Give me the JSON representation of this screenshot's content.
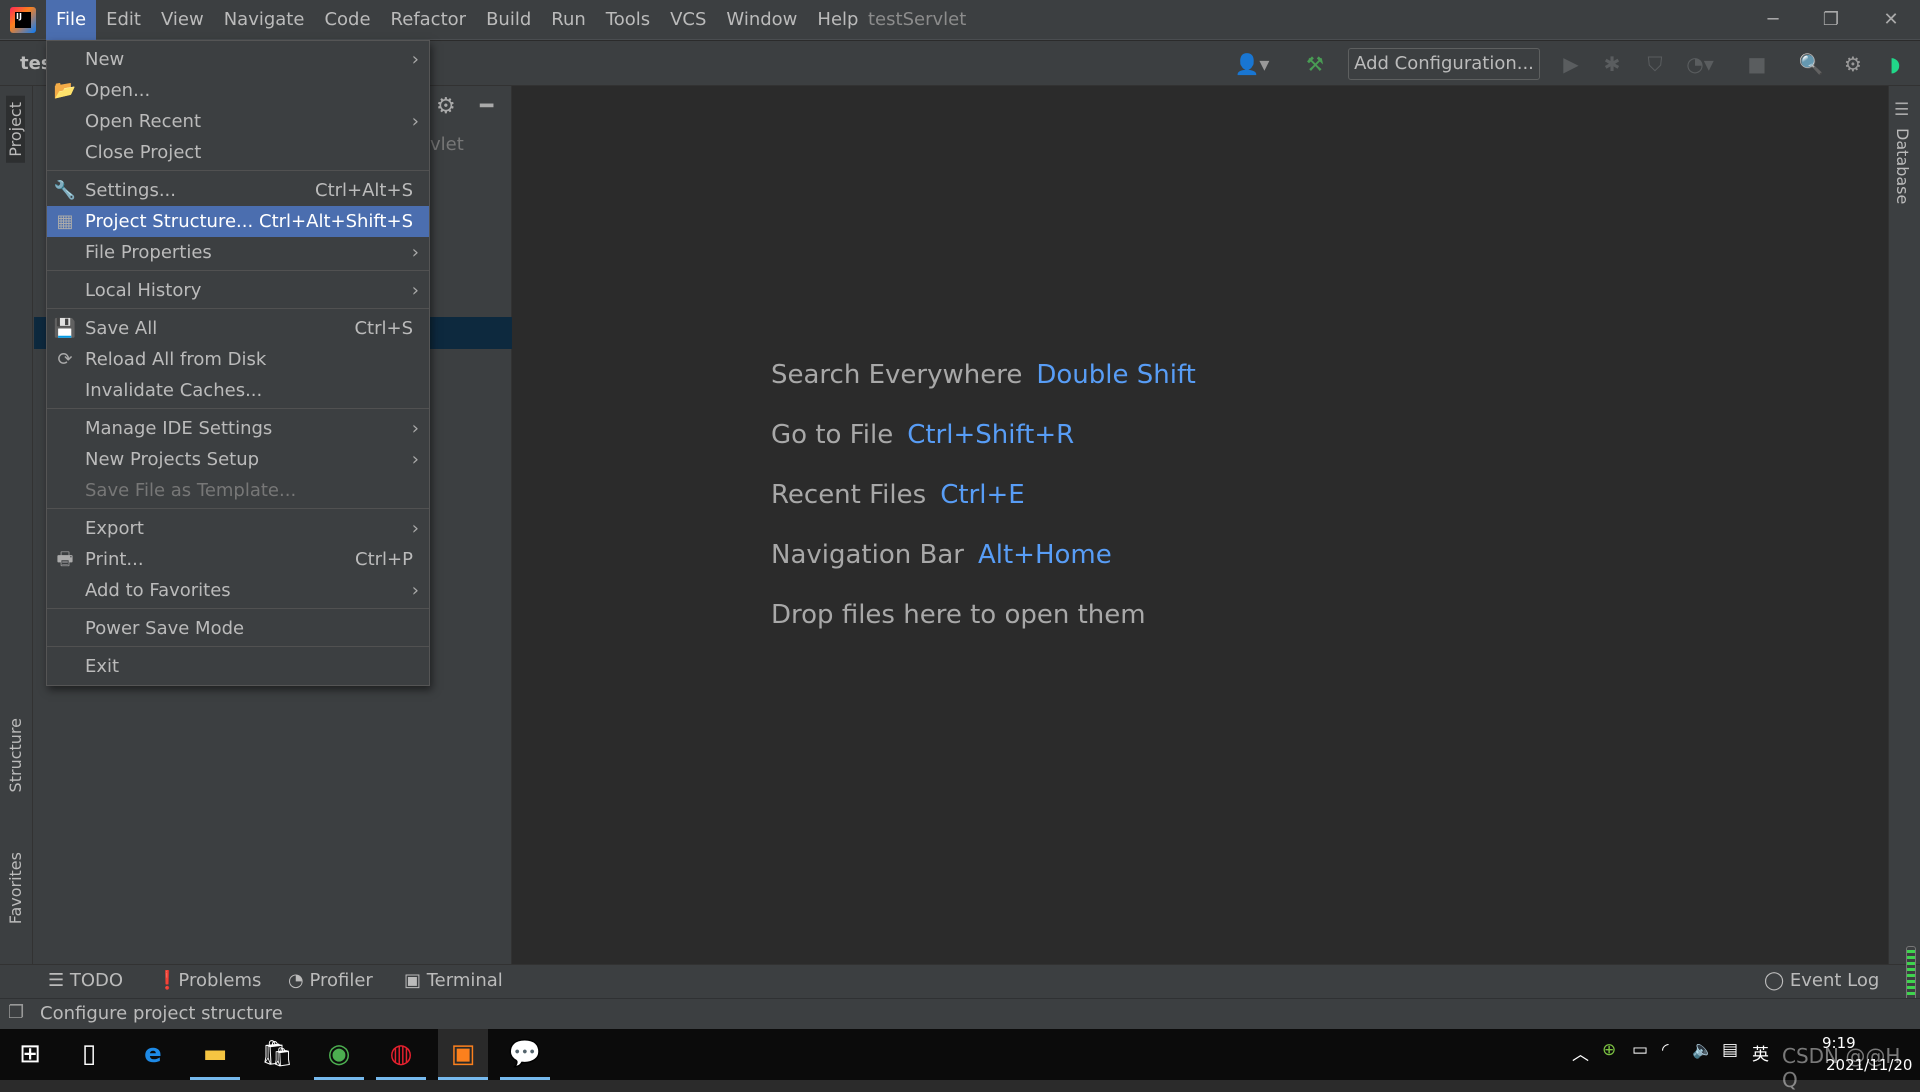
{
  "window": {
    "title": "testServlet"
  },
  "menubar": [
    "File",
    "Edit",
    "View",
    "Navigate",
    "Code",
    "Refactor",
    "Build",
    "Run",
    "Tools",
    "VCS",
    "Window",
    "Help"
  ],
  "nav": {
    "crumb": "testServlet"
  },
  "toolbar": {
    "add_configuration": "Add Configuration..."
  },
  "project_panel": {
    "tab": "Project",
    "partial_label": "vlet"
  },
  "left_stripe": {
    "project": "Project",
    "structure": "Structure",
    "favorites": "Favorites"
  },
  "right_stripe": {
    "database": "Database"
  },
  "file_menu": [
    {
      "label": "New",
      "submenu": true
    },
    {
      "label": "Open...",
      "icon": "folder-open-icon",
      "glyph": "📂"
    },
    {
      "label": "Open Recent",
      "submenu": true
    },
    {
      "label": "Close Project"
    },
    {
      "sep": true
    },
    {
      "label": "Settings...",
      "shortcut": "Ctrl+Alt+S",
      "icon": "wrench-icon",
      "glyph": "🔧"
    },
    {
      "label": "Project Structure...",
      "shortcut": "Ctrl+Alt+Shift+S",
      "icon": "project-structure-icon",
      "glyph": "▦",
      "highlighted": true
    },
    {
      "label": "File Properties",
      "submenu": true
    },
    {
      "sep": true
    },
    {
      "label": "Local History",
      "submenu": true
    },
    {
      "sep": true
    },
    {
      "label": "Save All",
      "shortcut": "Ctrl+S",
      "icon": "save-icon",
      "glyph": "💾"
    },
    {
      "label": "Reload All from Disk",
      "icon": "reload-icon",
      "glyph": "⟳"
    },
    {
      "label": "Invalidate Caches..."
    },
    {
      "sep": true
    },
    {
      "label": "Manage IDE Settings",
      "submenu": true
    },
    {
      "label": "New Projects Setup",
      "submenu": true
    },
    {
      "label": "Save File as Template...",
      "disabled": true
    },
    {
      "sep": true
    },
    {
      "label": "Export",
      "submenu": true
    },
    {
      "label": "Print...",
      "shortcut": "Ctrl+P",
      "icon": "printer-icon",
      "glyph": "🖶"
    },
    {
      "label": "Add to Favorites",
      "submenu": true
    },
    {
      "sep": true
    },
    {
      "label": "Power Save Mode"
    },
    {
      "sep": true
    },
    {
      "label": "Exit"
    }
  ],
  "editor_hints": [
    {
      "label": "Search Everywhere",
      "shortcut": "Double Shift"
    },
    {
      "label": "Go to File",
      "shortcut": "Ctrl+Shift+R"
    },
    {
      "label": "Recent Files",
      "shortcut": "Ctrl+E"
    },
    {
      "label": "Navigation Bar",
      "shortcut": "Alt+Home"
    },
    {
      "label": "Drop files here to open them",
      "shortcut": ""
    }
  ],
  "bottom_tabs": {
    "todo": "TODO",
    "problems": "Problems",
    "profiler": "Profiler",
    "terminal": "Terminal",
    "event_log": "Event Log"
  },
  "status": {
    "text": "Configure project structure"
  },
  "taskbar": {
    "time": "9:19",
    "date": "2021/11/20",
    "ime": "英",
    "watermark": "CSDN @@H Q"
  },
  "colors": {
    "accent": "#4b6eaf",
    "link": "#589df6",
    "panel": "#3c3f41",
    "editor": "#2b2b2b"
  }
}
